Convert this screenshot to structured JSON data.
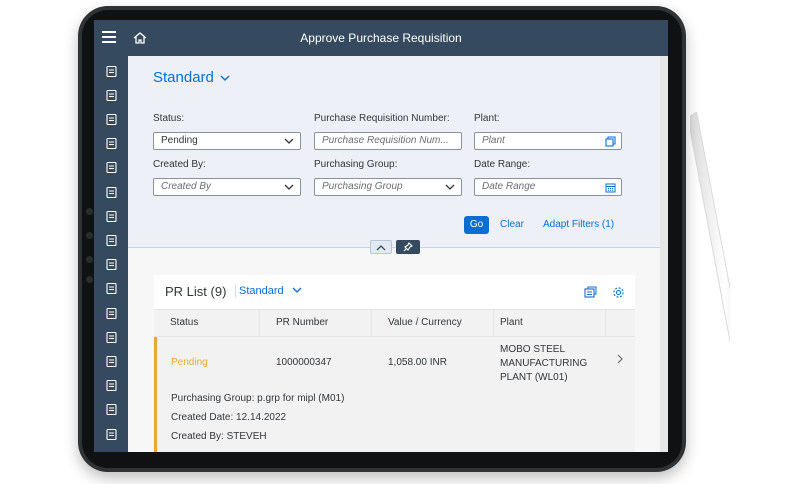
{
  "shell": {
    "title": "Approve Purchase Requisition"
  },
  "sidebar": {
    "icons": [
      "document-list-icon",
      "cube-icon",
      "document-settings-icon",
      "stamp-icon",
      "tools-icon",
      "inbox-arrow-icon",
      "document-icon",
      "copy-document-icon",
      "clipboard-icon",
      "checkmark-circle-icon",
      "form-icon",
      "notebook-icon",
      "truck-icon",
      "box-icon",
      "settings-document-icon",
      "edit-document-icon"
    ]
  },
  "filterbar": {
    "variant": "Standard",
    "filters": {
      "status": {
        "label": "Status:",
        "value": "Pending"
      },
      "pr_number": {
        "label": "Purchase Requisition Number:",
        "placeholder": "Purchase Requisition Num..."
      },
      "plant": {
        "label": "Plant:",
        "placeholder": "Plant"
      },
      "created_by": {
        "label": "Created By:",
        "placeholder": "Created By"
      },
      "purchasing_group": {
        "label": "Purchasing Group:",
        "placeholder": "Purchasing Group"
      },
      "date_range": {
        "label": "Date Range:",
        "placeholder": "Date Range"
      }
    },
    "go": "Go",
    "clear": "Clear",
    "adapt": "Adapt Filters (1)"
  },
  "list": {
    "title": "PR List (9)",
    "variant": "Standard",
    "columns": [
      "Status",
      "PR Number",
      "Value / Currency",
      "Plant"
    ],
    "rows": [
      {
        "status": "Pending",
        "pr_number": "1000000347",
        "value": "1,058.00 INR",
        "plant": [
          "MOBO STEEL",
          "MANUFACTURING",
          "PLANT (WL01)"
        ],
        "details": [
          {
            "label": "Purchasing Group:",
            "value": "p.grp for mipl (M01)"
          },
          {
            "label": "Created Date:",
            "value": "12.14.2022"
          },
          {
            "label": "Created By:",
            "value": "STEVEH"
          }
        ]
      }
    ]
  },
  "colors": {
    "shell": "#354a5f",
    "accent": "#0a6ed1",
    "pending": "#e9a930"
  }
}
